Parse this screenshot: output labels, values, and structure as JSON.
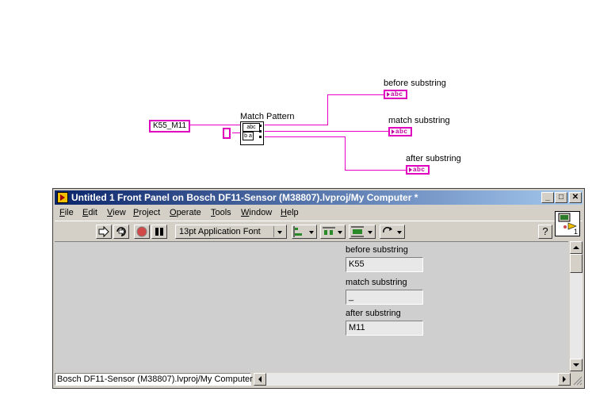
{
  "diagram": {
    "string_constant": "K55_M11",
    "node_label": "Match Pattern",
    "node_glyph_top": "abc",
    "node_glyph_mid": "b a",
    "indicator_glyph": "abc",
    "out_before_label": "before substring",
    "out_match_label": "match substring",
    "out_after_label": "after substring"
  },
  "window": {
    "title": "Untitled 1 Front Panel on Bosch DF11-Sensor (M38807).lvproj/My Computer *",
    "minimize": "_",
    "maximize": "□",
    "close": "✕",
    "menus": [
      {
        "key": "F",
        "rest": "ile"
      },
      {
        "key": "E",
        "rest": "dit"
      },
      {
        "key": "V",
        "rest": "iew"
      },
      {
        "key": "P",
        "rest": "roject"
      },
      {
        "key": "O",
        "rest": "perate"
      },
      {
        "key": "T",
        "rest": "ools"
      },
      {
        "key": "W",
        "rest": "indow"
      },
      {
        "key": "H",
        "rest": "elp"
      }
    ],
    "font_selector": "13pt Application Font",
    "help_glyph": "?",
    "connector_number": "1",
    "status_path": "Bosch DF11-Sensor (M38807).lvproj/My Computer"
  },
  "panel": {
    "before_label": "before substring",
    "before_value": "K55",
    "match_label": "match substring",
    "match_value": "_",
    "after_label": "after substring",
    "after_value": "M11"
  },
  "colors": {
    "string_wire": "#e800c8",
    "titlebar_start": "#0a246a",
    "titlebar_end": "#a6caf0",
    "panel_bg": "#cfcfcf"
  },
  "icons": [
    "run-arrow-icon",
    "run-continuously-icon",
    "abort-icon",
    "pause-icon",
    "align-icon",
    "distribute-icon",
    "resize-icon",
    "reorder-icon",
    "help-icon",
    "vi-connector-icon"
  ]
}
